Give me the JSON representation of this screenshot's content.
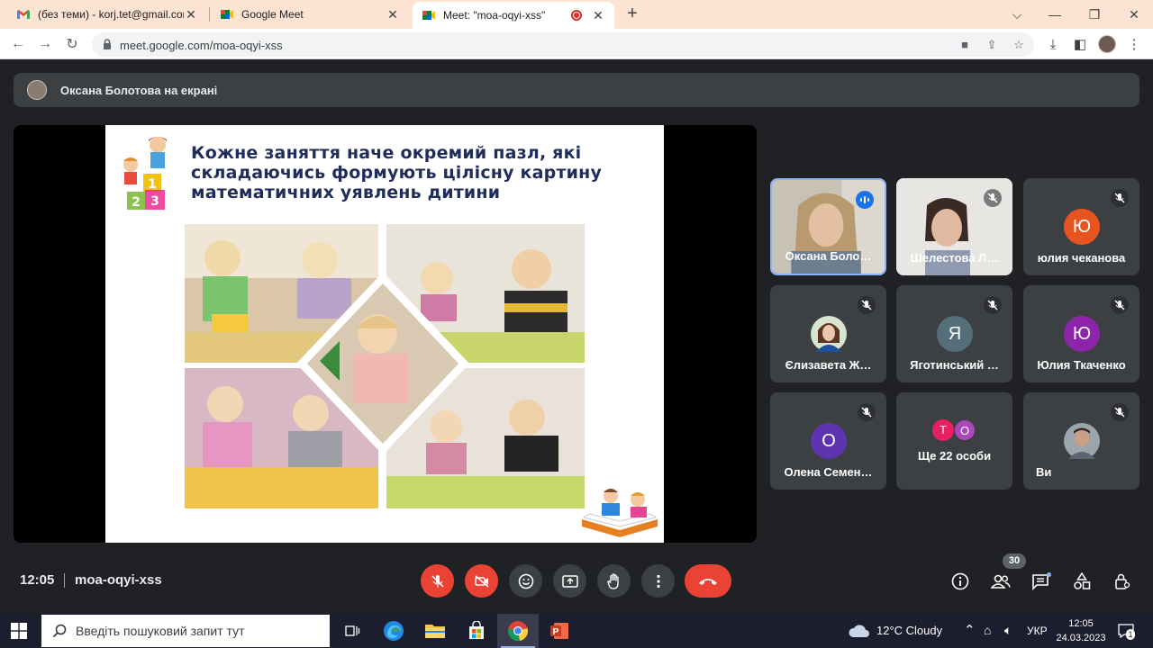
{
  "browser": {
    "tabs": [
      {
        "title": "(без теми) - korj.tet@gmail.com",
        "icon": "gmail-icon"
      },
      {
        "title": "Google Meet",
        "icon": "meet-icon"
      },
      {
        "title": "Meet: \"moa-oqyi-xss\"",
        "icon": "meet-icon",
        "active": true,
        "recording": true
      }
    ],
    "url": "meet.google.com/moa-oqyi-xss"
  },
  "meet": {
    "presenting_label": "Оксана Болотова на екрані",
    "slide": {
      "title": "Кожне заняття наче окремий пазл, які складаючись формують цілісну картину математичних уявлень дитини"
    },
    "participants": [
      {
        "name": "Оксана Боло…",
        "video": true,
        "speaking": true
      },
      {
        "name": "Шелестова Л…",
        "video": true,
        "muted": true
      },
      {
        "name": "юлия чеканова",
        "letter": "Ю",
        "color": "#e8541f",
        "muted": true
      },
      {
        "name": "Єлизавета Ж…",
        "avatar": true,
        "muted": true
      },
      {
        "name": "Яготинський …",
        "letter": "Я",
        "color": "#546e7a",
        "muted": true
      },
      {
        "name": "Юлия Ткаченко",
        "letter": "Ю",
        "color": "#8e24aa",
        "muted": true
      },
      {
        "name": "Олена Семен…",
        "letter": "О",
        "color": "#5e35b1",
        "muted": true
      },
      {
        "name": "Ще 22 особи",
        "mini": [
          "Т",
          "О"
        ]
      },
      {
        "name": "Ви",
        "avatar": true,
        "muted": true
      }
    ],
    "time": "12:05",
    "meeting_code": "moa-oqyi-xss",
    "participant_count": "30"
  },
  "taskbar": {
    "search_placeholder": "Введіть пошуковий запит тут",
    "weather": "12°C  Cloudy",
    "language": "УКР",
    "time": "12:05",
    "date": "24.03.2023",
    "notification_count": "1"
  },
  "colors": {
    "meet_bg": "#202124",
    "tile_bg": "#3c4043",
    "danger": "#ea4335",
    "speaking_border": "#8ab4f8"
  }
}
